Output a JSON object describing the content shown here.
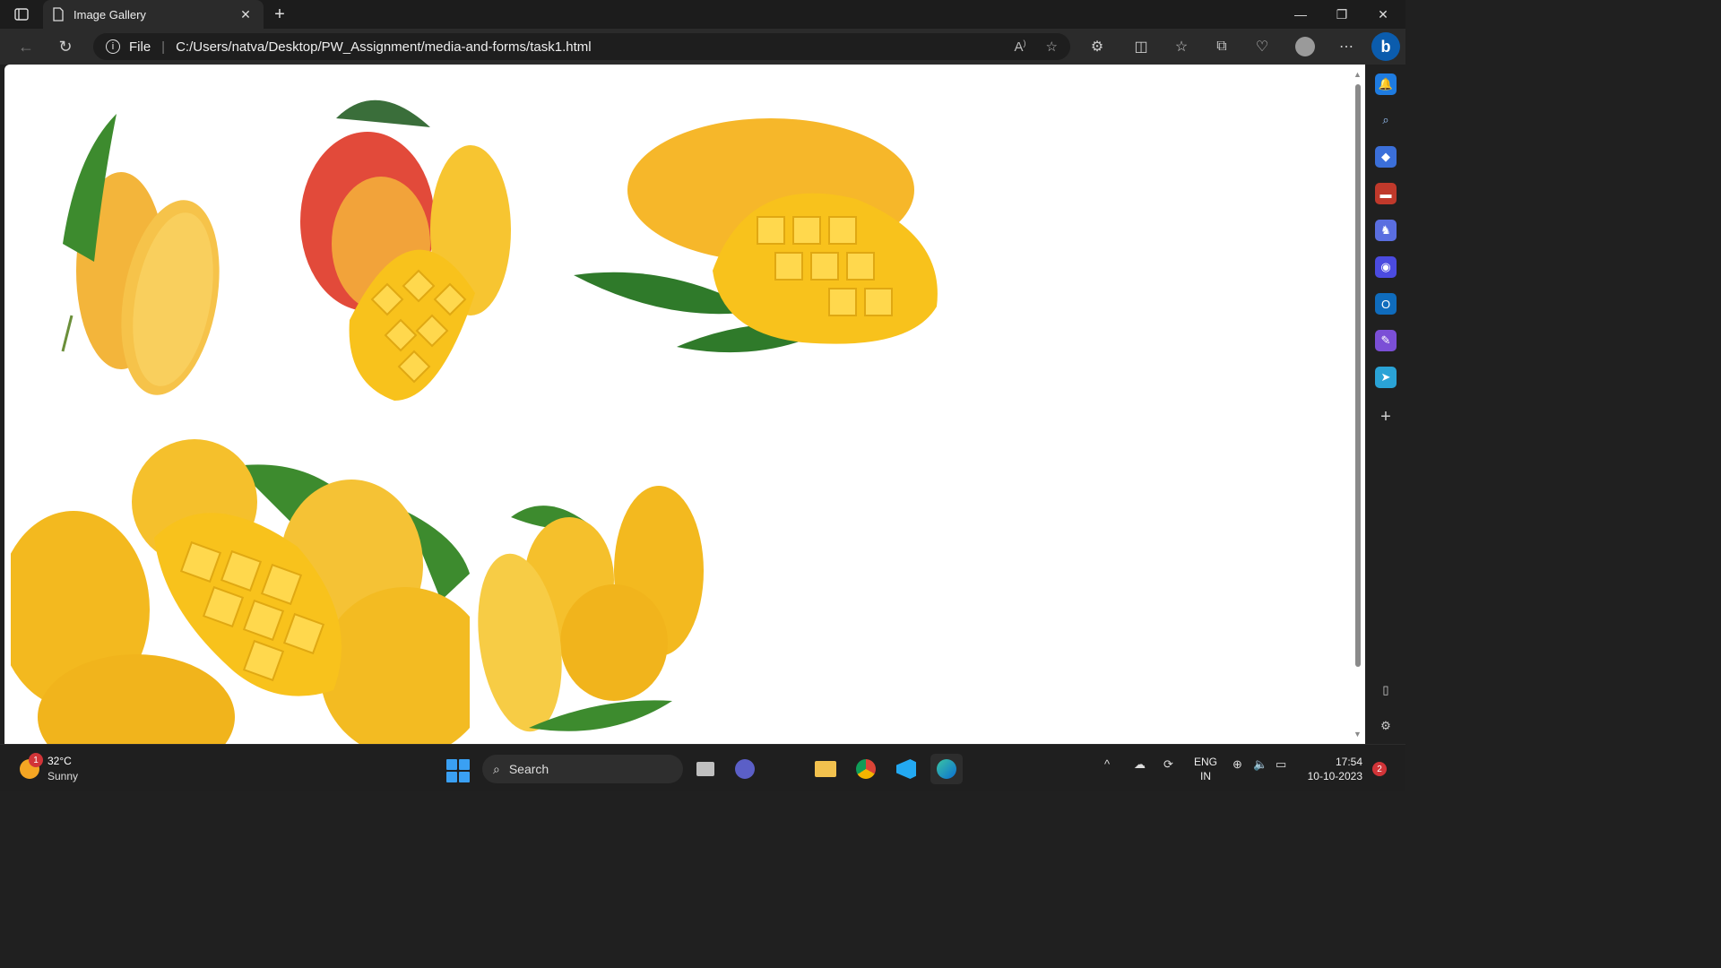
{
  "browser": {
    "tab": {
      "title": "Image Gallery"
    },
    "address": {
      "protocol_label": "File",
      "url": "C:/Users/natva/Desktop/PW_Assignment/media-and-forms/task1.html"
    }
  },
  "gallery": {
    "images": [
      {
        "name": "mango-with-leaf-and-half-image"
      },
      {
        "name": "red-mango-diced-hedgehog-image"
      },
      {
        "name": "yellow-mango-diced-with-leaves-image"
      },
      {
        "name": "basket-of-mangoes-image"
      },
      {
        "name": "mango-pile-with-slice-image"
      }
    ]
  },
  "taskbar": {
    "weather": {
      "badge": "1",
      "temperature": "32°C",
      "condition": "Sunny"
    },
    "search_label": "Search",
    "language": {
      "line1": "ENG",
      "line2": "IN"
    },
    "clock": {
      "time": "17:54",
      "date": "10-10-2023"
    },
    "notification_count": "2"
  },
  "colors": {
    "accent": "#0b5cad",
    "mango_yellow": "#f8c21c",
    "leaf_green": "#3d8b2e"
  }
}
